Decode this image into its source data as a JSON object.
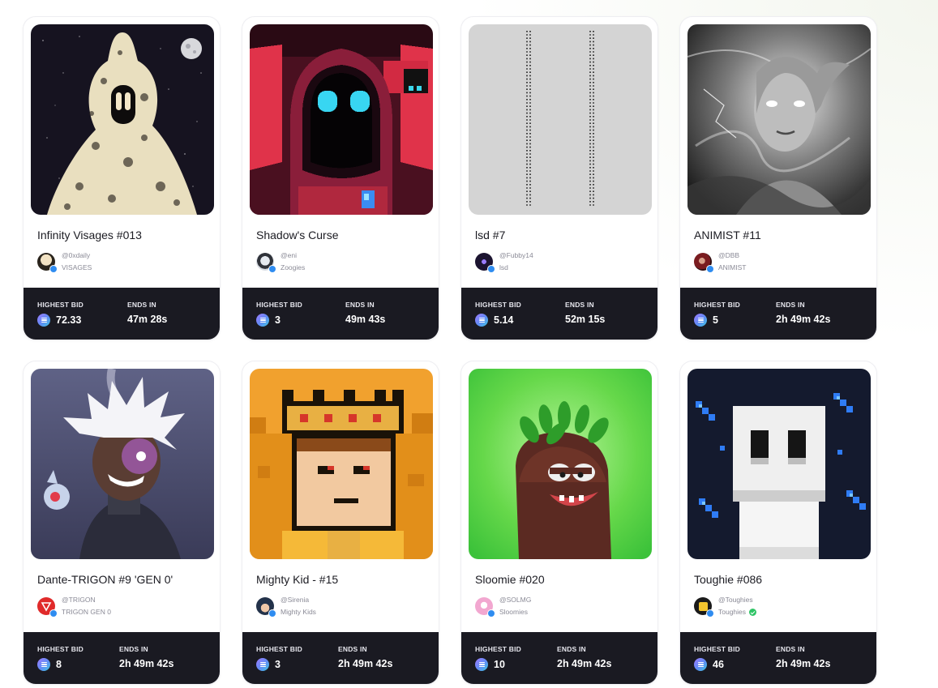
{
  "labels": {
    "highest_bid": "HIGHEST BID",
    "ends_in": "ENDS IN"
  },
  "currency_icon": "solana-icon",
  "cards": [
    {
      "title": "Infinity Visages #013",
      "handle": "@0xdaily",
      "collection": "VISAGES",
      "bid": "72.33",
      "ends": "47m 28s",
      "art": "doodle-figure"
    },
    {
      "title": "Shadow's Curse",
      "handle": "@eni",
      "collection": "Zoogies",
      "bid": "3",
      "ends": "49m 43s",
      "art": "pixel-hooded-figure"
    },
    {
      "title": "lsd #7",
      "handle": "@Fubby14",
      "collection": "lsd",
      "bid": "5.14",
      "ends": "52m 15s",
      "art": "grey-dotted-lines"
    },
    {
      "title": "ANIMIST #11",
      "handle": "@DBB",
      "collection": "ANIMIST",
      "bid": "5",
      "ends": "2h 49m 42s",
      "art": "storm-woman-portrait"
    },
    {
      "title": "Dante-TRIGON #9 'GEN 0'",
      "handle": "@TRIGON",
      "collection": "TRIGON GEN 0",
      "bid": "8",
      "ends": "2h 49m 42s",
      "art": "anime-white-hair"
    },
    {
      "title": "Mighty Kid - #15",
      "handle": "@Sirenia",
      "collection": "Mighty Kids",
      "bid": "3",
      "ends": "2h 49m 42s",
      "art": "pixel-crowned-kid"
    },
    {
      "title": "Sloomie #020",
      "handle": "@SOLMG",
      "collection": "Sloomies",
      "bid": "10",
      "ends": "2h 49m 42s",
      "art": "3d-green-monster"
    },
    {
      "title": "Toughie #086",
      "handle": "@Toughies",
      "collection": "Toughies",
      "bid": "46",
      "ends": "2h 49m 42s",
      "art": "pixel-ghost",
      "collection_verified": true
    }
  ]
}
